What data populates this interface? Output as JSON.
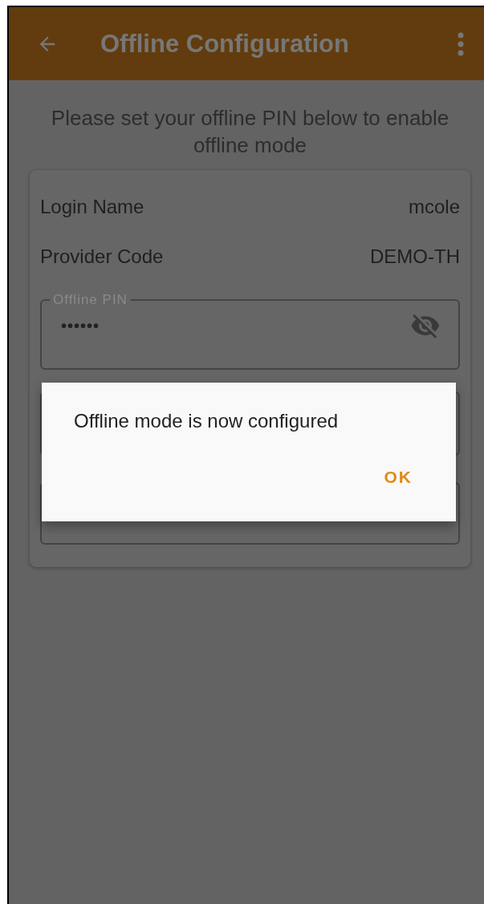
{
  "app_bar": {
    "title": "Offline Configuration"
  },
  "instructions": "Please set your offline PIN below to enable offline mode",
  "details": [
    {
      "label": "Login Name",
      "value": "mcole"
    },
    {
      "label": "Provider Code",
      "value": "DEMO-TH"
    }
  ],
  "pin_field": {
    "label": "Offline PIN",
    "value": "••••••",
    "masked": true
  },
  "dialog": {
    "message": "Offline mode is now configured",
    "buttons": [
      "OK"
    ]
  }
}
